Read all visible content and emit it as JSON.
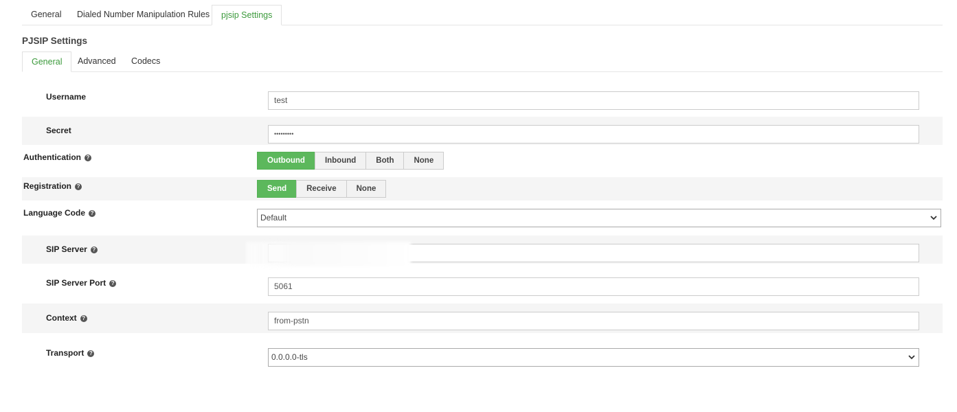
{
  "top_tabs": [
    {
      "label": "General",
      "active": false
    },
    {
      "label": "Dialed Number Manipulation Rules",
      "active": false
    },
    {
      "label": "pjsip Settings",
      "active": true
    }
  ],
  "section_title": "PJSIP Settings",
  "sub_tabs": [
    {
      "label": "General",
      "active": true
    },
    {
      "label": "Advanced",
      "active": false
    },
    {
      "label": "Codecs",
      "active": false
    }
  ],
  "fields": {
    "username": {
      "label": "Username",
      "value": "test"
    },
    "secret": {
      "label": "Secret",
      "value": "•••••••••"
    },
    "authentication": {
      "label": "Authentication",
      "options": [
        "Outbound",
        "Inbound",
        "Both",
        "None"
      ],
      "selected": "Outbound"
    },
    "registration": {
      "label": "Registration",
      "options": [
        "Send",
        "Receive",
        "None"
      ],
      "selected": "Send"
    },
    "language_code": {
      "label": "Language Code",
      "value": "Default"
    },
    "sip_server": {
      "label": "SIP Server",
      "value": ""
    },
    "sip_server_port": {
      "label": "SIP Server Port",
      "value": "5061"
    },
    "context": {
      "label": "Context",
      "value": "from-pstn"
    },
    "transport": {
      "label": "Transport",
      "value": "0.0.0.0-tls"
    }
  },
  "colors": {
    "accent": "#5cb85c",
    "tab_active_text": "#3c9a3c",
    "row_shade": "#f5f5f5"
  },
  "icons": {
    "help": "question-circle-icon",
    "dropdown": "chevron-down-icon"
  }
}
